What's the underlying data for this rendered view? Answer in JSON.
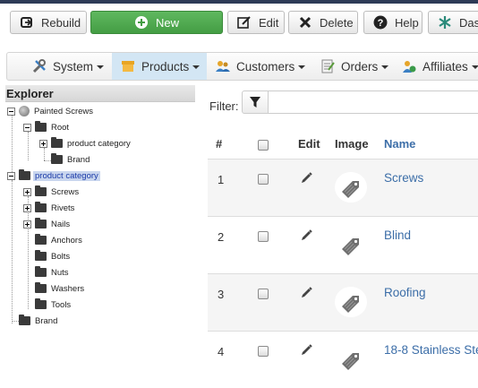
{
  "toolbar": {
    "rebuild_label": "Rebuild",
    "new_label": "New",
    "edit_label": "Edit",
    "delete_label": "Delete",
    "help_label": "Help",
    "dash_label": "Dash"
  },
  "nav": {
    "items": [
      {
        "label": "System",
        "icon": "tools-icon"
      },
      {
        "label": "Products",
        "icon": "box-icon"
      },
      {
        "label": "Customers",
        "icon": "users-icon"
      },
      {
        "label": "Orders",
        "icon": "orders-icon"
      },
      {
        "label": "Affiliates",
        "icon": "affiliates-icon"
      }
    ],
    "active_index": 1
  },
  "explorer": {
    "title": "Explorer",
    "tree": {
      "painted_screws": "Painted Screws",
      "root": "Root",
      "product_category_inner": "product category",
      "brand_inner": "Brand",
      "product_category": "product category",
      "screws": "Screws",
      "rivets": "Rivets",
      "nails": "Nails",
      "anchors": "Anchors",
      "bolts": "Bolts",
      "nuts": "Nuts",
      "washers": "Washers",
      "tools": "Tools",
      "brand": "Brand"
    }
  },
  "filter": {
    "label": "Filter:",
    "value": ""
  },
  "grid": {
    "headers": {
      "num": "#",
      "edit": "Edit",
      "image": "Image",
      "name": "Name"
    },
    "rows": [
      {
        "num": "1",
        "name": "Screws"
      },
      {
        "num": "2",
        "name": "Blind"
      },
      {
        "num": "3",
        "name": "Roofing"
      },
      {
        "num": "4",
        "name": "18-8 Stainless Ste"
      }
    ]
  },
  "colors": {
    "accent_green": "#449d44",
    "link_blue": "#3c6ea8",
    "nav_active": "#d3e6f4",
    "selection": "#c9d6ee"
  }
}
